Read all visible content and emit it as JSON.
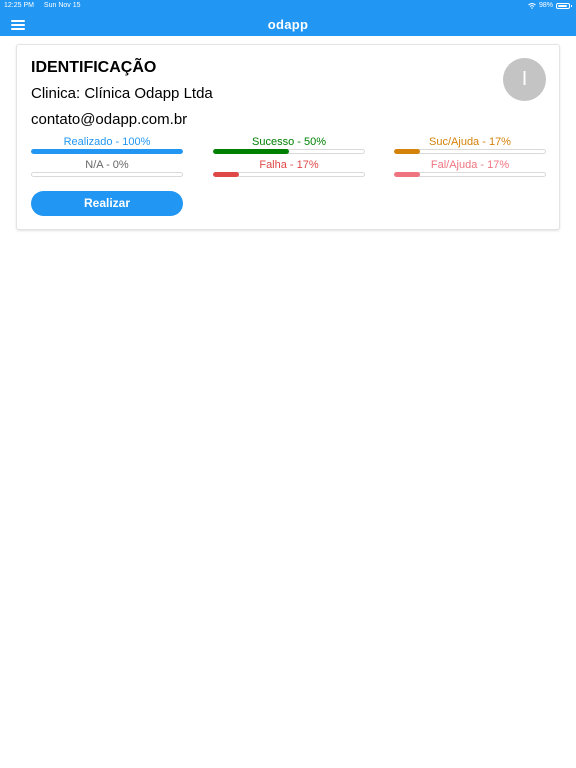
{
  "status_bar": {
    "time": "12:25 PM",
    "date": "Sun Nov 15",
    "battery": "98%",
    "wifi_icon": "wifi-icon",
    "battery_icon": "battery-icon"
  },
  "app_bar": {
    "title": "odapp",
    "menu_icon": "menu-icon",
    "color": "#2196f3"
  },
  "card": {
    "title": "IDENTIFICAÇÃO",
    "clinic": "Clinica: Clínica Odapp Ltda",
    "email": "contato@odapp.com.br",
    "avatar_initial": "I",
    "stats": [
      {
        "label": "Realizado - 100%",
        "value": 1.0,
        "color": "#2196f3"
      },
      {
        "label": "Sucesso - 50%",
        "value": 0.5,
        "color": "#008000"
      },
      {
        "label": "Suc/Ajuda - 17%",
        "value": 0.17,
        "color": "#d4820a"
      },
      {
        "label": "N/A - 0%",
        "value": 0.0,
        "color": "#666666"
      },
      {
        "label": "Falha - 17%",
        "value": 0.17,
        "color": "#e04848"
      },
      {
        "label": "Fal/Ajuda - 17%",
        "value": 0.17,
        "color": "#ef7480"
      }
    ],
    "action_label": "Realizar"
  }
}
